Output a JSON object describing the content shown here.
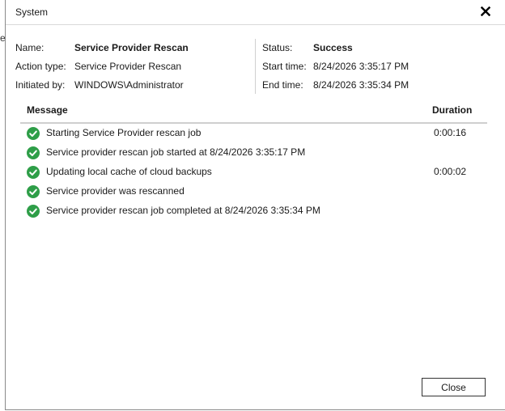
{
  "window": {
    "title": "System",
    "background_fragment": "en"
  },
  "summary": {
    "left": [
      {
        "label": "Name:",
        "value": "Service Provider Rescan",
        "bold": true
      },
      {
        "label": "Action type:",
        "value": "Service Provider Rescan",
        "bold": false
      },
      {
        "label": "Initiated by:",
        "value": "WINDOWS\\Administrator",
        "bold": false
      }
    ],
    "right": [
      {
        "label": "Status:",
        "value": "Success",
        "bold": true
      },
      {
        "label": "Start time:",
        "value": "8/24/2026 3:35:17 PM",
        "bold": false
      },
      {
        "label": "End time:",
        "value": "8/24/2026 3:35:34 PM",
        "bold": false
      }
    ]
  },
  "log": {
    "columns": {
      "message": "Message",
      "duration": "Duration"
    },
    "rows": [
      {
        "icon": "success-check-icon",
        "message": "Starting Service Provider rescan job",
        "duration": "0:00:16"
      },
      {
        "icon": "success-check-icon",
        "message": "Service provider rescan job started at 8/24/2026 3:35:17 PM",
        "duration": ""
      },
      {
        "icon": "success-check-icon",
        "message": "Updating local cache of cloud backups",
        "duration": "0:00:02"
      },
      {
        "icon": "success-check-icon",
        "message": "Service provider was rescanned",
        "duration": ""
      },
      {
        "icon": "success-check-icon",
        "message": "Service provider rescan job completed at 8/24/2026 3:35:34 PM",
        "duration": ""
      }
    ]
  },
  "footer": {
    "close_label": "Close"
  },
  "colors": {
    "success_green": "#2e9e48",
    "border": "#8a8a8a"
  }
}
